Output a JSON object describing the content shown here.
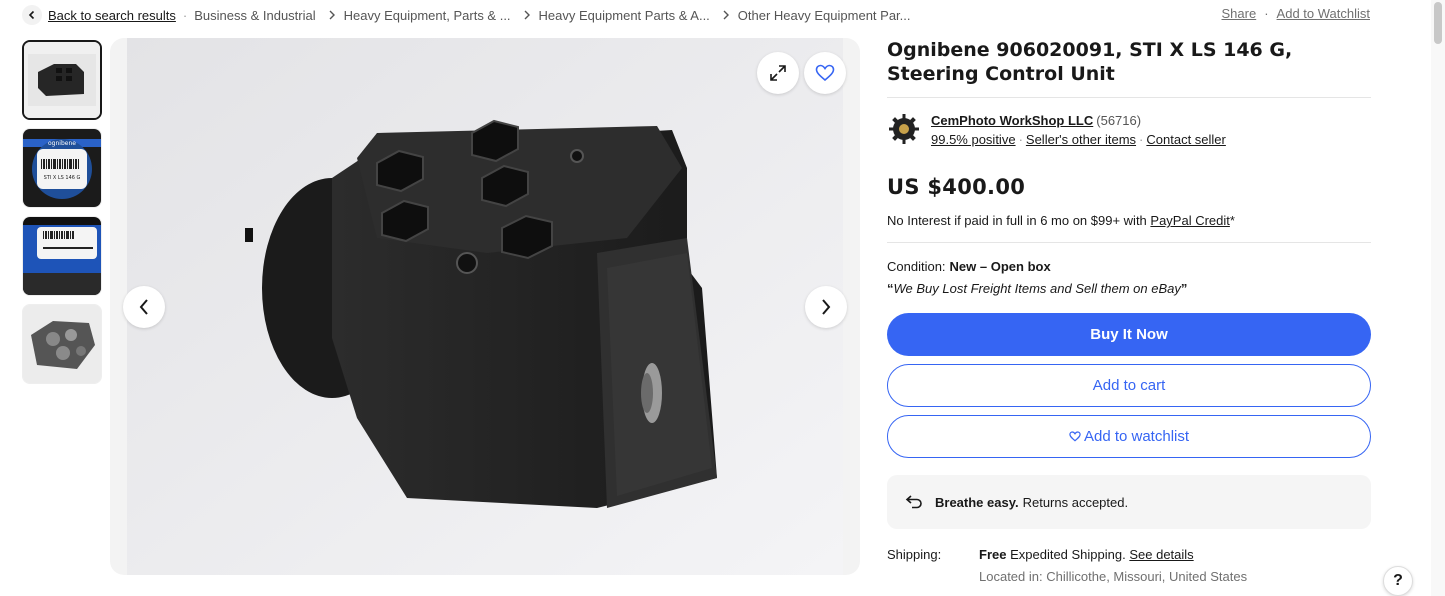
{
  "breadcrumb": {
    "back_label": "Back to search results",
    "items": [
      "Business & Industrial",
      "Heavy Equipment, Parts & ...",
      "Heavy Equipment Parts & A...",
      "Other Heavy Equipment Par..."
    ]
  },
  "top_actions": {
    "share": "Share",
    "watchlist": "Add to Watchlist"
  },
  "listing": {
    "title": "Ognibene 906020091, STI X LS 146 G, Steering Control Unit",
    "price": "US $400.00",
    "financing_text": "No Interest if paid in full in 6 mo on $99+ with ",
    "financing_link": "PayPal Credit",
    "financing_suffix": "*",
    "condition_label": "Condition:",
    "condition_value": "New – Open box",
    "seller_quote_open": "“",
    "seller_quote": "We Buy Lost Freight Items and Sell them on eBay",
    "seller_quote_close": "”"
  },
  "seller": {
    "name": "CemPhoto WorkShop LLC",
    "feedback_count": "(56716)",
    "positive": "99.5% positive",
    "other_items": "Seller's other items",
    "contact": "Contact seller"
  },
  "buttons": {
    "buy_now": "Buy It Now",
    "add_cart": "Add to cart",
    "add_watchlist": "Add to watchlist"
  },
  "returns": {
    "bold": "Breathe easy.",
    "text": "Returns accepted."
  },
  "shipping": {
    "label": "Shipping:",
    "free": "Free",
    "method": " Expedited Shipping. ",
    "details_link": "See details",
    "location": "Located in: Chillicothe, Missouri, United States"
  },
  "thumbnails": [
    {
      "name": "thumbnail-1",
      "caption": ""
    },
    {
      "name": "thumbnail-2",
      "caption": "ognibene"
    },
    {
      "name": "thumbnail-3",
      "caption": ""
    },
    {
      "name": "thumbnail-4",
      "caption": ""
    }
  ],
  "thumb2_label_text": "STI X LS 146 G",
  "help_label": "?",
  "colors": {
    "accent": "#3665f3",
    "text": "#191919",
    "muted": "#707070"
  }
}
